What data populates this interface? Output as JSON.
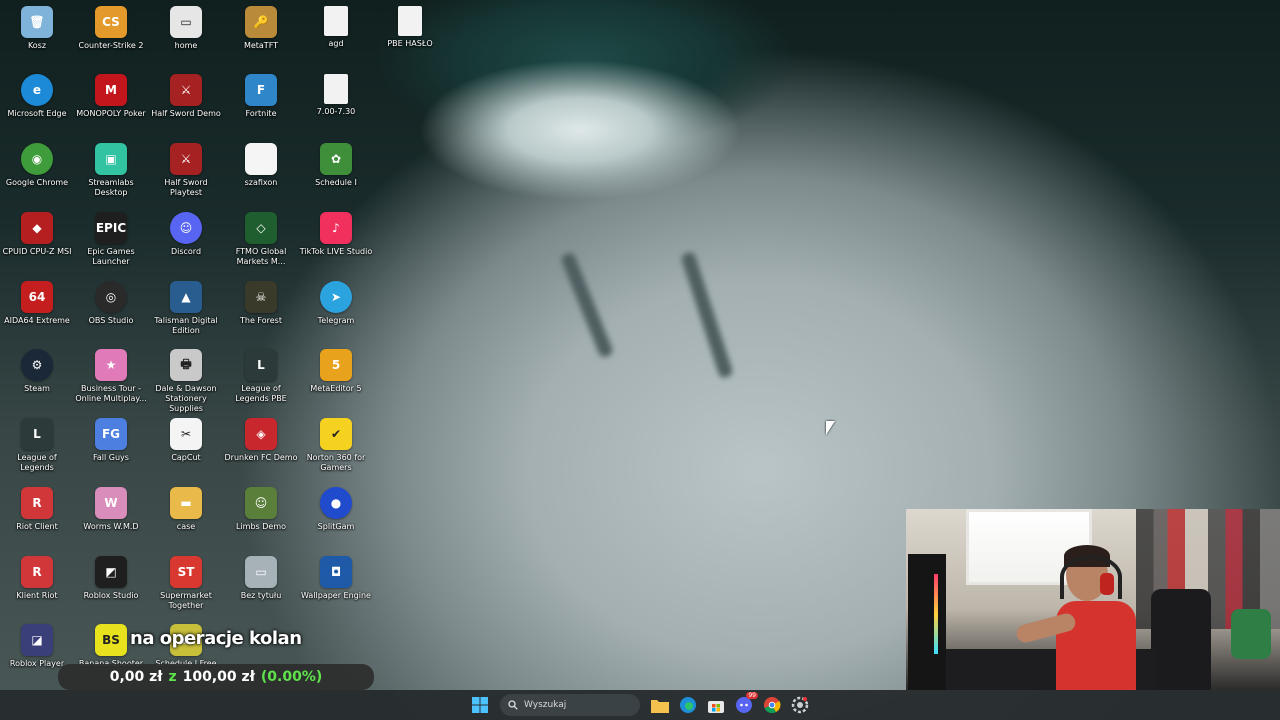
{
  "desktop": {
    "icons": [
      {
        "label": "Kosz",
        "icon": "recycle-bin-icon",
        "color": "#7fb3d9",
        "glyph": "🗑"
      },
      {
        "label": "Counter-Strike 2",
        "icon": "counter-strike-icon",
        "color": "#e49a2b",
        "glyph": "CS"
      },
      {
        "label": "home",
        "icon": "home-icon",
        "color": "#e6e6e6",
        "glyph": "▭"
      },
      {
        "label": "MetaTFT",
        "icon": "metatft-icon",
        "color": "#b88a3a",
        "glyph": "🔑"
      },
      {
        "label": "agd",
        "icon": "text-file-icon",
        "color": "#f2f2f2",
        "glyph": ""
      },
      {
        "label": "PBE HASŁO",
        "icon": "text-file-icon",
        "color": "#f2f2f2",
        "glyph": ""
      },
      {
        "label": "Microsoft Edge",
        "icon": "edge-icon",
        "color": "#1c8ad6",
        "glyph": "e"
      },
      {
        "label": "MONOPOLY Poker",
        "icon": "monopoly-icon",
        "color": "#c3161c",
        "glyph": "M"
      },
      {
        "label": "Half Sword Demo",
        "icon": "half-sword-icon",
        "color": "#a62222",
        "glyph": "⚔"
      },
      {
        "label": "Fortnite",
        "icon": "fortnite-icon",
        "color": "#2f86c9",
        "glyph": "F"
      },
      {
        "label": "7.00-7.30",
        "icon": "text-file-icon",
        "color": "#f2f2f2",
        "glyph": ""
      },
      {
        "label": "Google Chrome",
        "icon": "chrome-icon",
        "color": "#3f9c3a",
        "glyph": "◉"
      },
      {
        "label": "Streamlabs Desktop",
        "icon": "streamlabs-icon",
        "color": "#31c3a2",
        "glyph": "▣"
      },
      {
        "label": "Half Sword Playtest",
        "icon": "half-sword-icon",
        "color": "#a62222",
        "glyph": "⚔"
      },
      {
        "label": "szafixon",
        "icon": "image-file-icon",
        "color": "#f5f5f5",
        "glyph": ""
      },
      {
        "label": "Schedule I",
        "icon": "schedule-icon",
        "color": "#3f8f3a",
        "glyph": "✿"
      },
      {
        "label": "CPUID CPU-Z MSI",
        "icon": "cpuz-icon",
        "color": "#b51f1f",
        "glyph": "◆"
      },
      {
        "label": "Epic Games Launcher",
        "icon": "epic-games-icon",
        "color": "#1f1f1f",
        "glyph": "EPIC"
      },
      {
        "label": "Discord",
        "icon": "discord-icon",
        "color": "#5865f2",
        "glyph": "☺"
      },
      {
        "label": "FTMO Global Markets M...",
        "icon": "ftmo-icon",
        "color": "#1f5e2f",
        "glyph": "◇"
      },
      {
        "label": "TikTok LIVE Studio",
        "icon": "tiktok-icon",
        "color": "#f2305e",
        "glyph": "♪"
      },
      {
        "label": "AIDA64 Extreme",
        "icon": "aida64-icon",
        "color": "#c41e1e",
        "glyph": "64"
      },
      {
        "label": "OBS Studio",
        "icon": "obs-icon",
        "color": "#2a2a2a",
        "glyph": "◎"
      },
      {
        "label": "Talisman Digital Edition",
        "icon": "talisman-icon",
        "color": "#2a5d8f",
        "glyph": "▲"
      },
      {
        "label": "The Forest",
        "icon": "the-forest-icon",
        "color": "#3a3a2a",
        "glyph": "☠"
      },
      {
        "label": "Telegram",
        "icon": "telegram-icon",
        "color": "#2aa3df",
        "glyph": "➤"
      },
      {
        "label": "Steam",
        "icon": "steam-icon",
        "color": "#1b2838",
        "glyph": "⚙"
      },
      {
        "label": "Business Tour - Online Multiplay...",
        "icon": "business-tour-icon",
        "color": "#e07ab8",
        "glyph": "★"
      },
      {
        "label": "Dale & Dawson Stationery Supplies",
        "icon": "printer-icon",
        "color": "#c9c9c9",
        "glyph": "🖶"
      },
      {
        "label": "League of Legends PBE",
        "icon": "league-of-legends-icon",
        "color": "#2c3a3a",
        "glyph": "L"
      },
      {
        "label": "MetaEditor 5",
        "icon": "metaeditor-icon",
        "color": "#e8a21b",
        "glyph": "5"
      },
      {
        "label": "League of Legends",
        "icon": "league-of-legends-icon",
        "color": "#2c3a3a",
        "glyph": "L"
      },
      {
        "label": "Fall Guys",
        "icon": "fall-guys-icon",
        "color": "#4d7fe0",
        "glyph": "FG"
      },
      {
        "label": "CapCut",
        "icon": "capcut-icon",
        "color": "#f4f4f4",
        "glyph": "✂"
      },
      {
        "label": "Drunken FC Demo",
        "icon": "drunken-fc-icon",
        "color": "#c8272d",
        "glyph": "◈"
      },
      {
        "label": "Norton 360 for Gamers",
        "icon": "norton-icon",
        "color": "#f4d21f",
        "glyph": "✔"
      },
      {
        "label": "Riot Client",
        "icon": "riot-client-icon",
        "color": "#d13639",
        "glyph": "R"
      },
      {
        "label": "Worms W.M.D",
        "icon": "worms-icon",
        "color": "#d98dbb",
        "glyph": "W"
      },
      {
        "label": "case",
        "icon": "folder-icon",
        "color": "#e9b949",
        "glyph": "▬"
      },
      {
        "label": "Limbs Demo",
        "icon": "limbs-icon",
        "color": "#5a7f3a",
        "glyph": "☺"
      },
      {
        "label": "SplitGam",
        "icon": "splitgam-icon",
        "color": "#1f4bcc",
        "glyph": "●"
      },
      {
        "label": "Klient Riot",
        "icon": "riot-client-icon",
        "color": "#d13639",
        "glyph": "R"
      },
      {
        "label": "Roblox Studio",
        "icon": "roblox-studio-icon",
        "color": "#1f1f1f",
        "glyph": "◩"
      },
      {
        "label": "Supermarket Together",
        "icon": "supermarket-icon",
        "color": "#d8382f",
        "glyph": "ST"
      },
      {
        "label": "Bez tytułu",
        "icon": "image-file-icon",
        "color": "#a6b1b8",
        "glyph": "▭"
      },
      {
        "label": "Wallpaper Engine",
        "icon": "wallpaper-engine-icon",
        "color": "#1e5aa8",
        "glyph": "◘"
      },
      {
        "label": "Roblox Player",
        "icon": "roblox-icon",
        "color": "#3a3f7a",
        "glyph": "◪"
      },
      {
        "label": "Banana Shooter",
        "icon": "banana-shooter-icon",
        "color": "#e8e21e",
        "glyph": "BS"
      },
      {
        "label": "Schedule I Free",
        "icon": "schedule-icon",
        "color": "#c9c03a",
        "glyph": "✿"
      }
    ]
  },
  "overlay": {
    "caption": "na operacje kolan",
    "goal_current": "0,00 zł",
    "goal_sep": "z",
    "goal_target": "100,00 zł",
    "goal_percent": "(0.00%)"
  },
  "taskbar": {
    "search_placeholder": "Wyszukaj",
    "discord_badge": "99"
  }
}
